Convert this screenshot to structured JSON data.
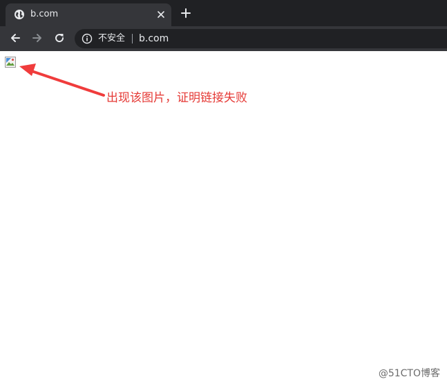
{
  "tab": {
    "title": "b.com",
    "favicon": "globe-icon",
    "close": "close-icon"
  },
  "newtab": {
    "icon": "plus-icon"
  },
  "toolbar": {
    "back_icon": "back-arrow-icon",
    "forward_icon": "forward-arrow-icon",
    "reload_icon": "reload-icon"
  },
  "omnibox": {
    "info_icon": "info-icon",
    "security_label": "不安全",
    "url": "b.com"
  },
  "content": {
    "image_icon": "broken-image-icon",
    "annotation": "出现该图片，证明链接失败",
    "annotation_color": "#e53935"
  },
  "watermark": "@51CTO博客",
  "colors": {
    "tabstrip": "#202124",
    "toolbar": "#35363a",
    "omnibox": "#202124"
  }
}
